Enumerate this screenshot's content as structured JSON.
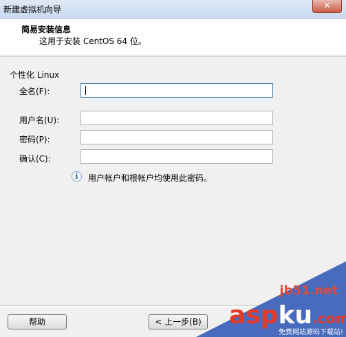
{
  "window": {
    "title": "新建虚拟机向导",
    "close_label": "✕"
  },
  "header": {
    "title": "简易安装信息",
    "subtitle": "这用于安装 CentOS 64 位。"
  },
  "section": {
    "label": "个性化 Linux"
  },
  "fields": {
    "fullname": {
      "label": "全名(F):",
      "value": ""
    },
    "username": {
      "label": "用户名(U):",
      "value": ""
    },
    "password": {
      "label": "密码(P):",
      "value": ""
    },
    "confirm": {
      "label": "确认(C):",
      "value": ""
    }
  },
  "info": {
    "icon": "info-icon",
    "glyph": "i",
    "text": "用户帐户和根帐户均使用此密码。"
  },
  "buttons": {
    "help": "帮助",
    "back": "< 上一步(B)"
  },
  "watermark": {
    "site": "jb51.net",
    "brand_asp": "asp",
    "brand_ku": "ku",
    "brand_com": ".com",
    "footer": "免费网站源码下载站!"
  }
}
